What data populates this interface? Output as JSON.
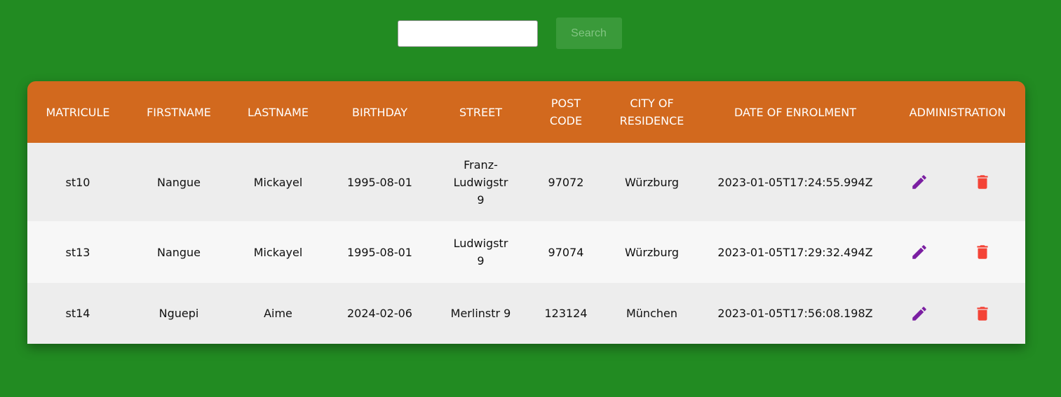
{
  "search": {
    "value": "",
    "placeholder": "",
    "button_label": "Search"
  },
  "table": {
    "headers": [
      "Matricule",
      "Firstname",
      "Lastname",
      "Birthday",
      "Street",
      "Post code",
      "City of residence",
      "Date of enrolment",
      "Administration"
    ],
    "rows": [
      {
        "matricule": "st10",
        "firstname": "Nangue",
        "lastname": "Mickayel",
        "birthday": "1995-08-01",
        "street": "Franz-Ludwigstr 9",
        "post_code": "97072",
        "city": "Würzburg",
        "enrolment": "2023-01-05T17:24:55.994Z"
      },
      {
        "matricule": "st13",
        "firstname": "Nangue",
        "lastname": "Mickayel",
        "birthday": "1995-08-01",
        "street": "Ludwigstr 9",
        "post_code": "97074",
        "city": "Würzburg",
        "enrolment": "2023-01-05T17:29:32.494Z"
      },
      {
        "matricule": "st14",
        "firstname": "Nguepi",
        "lastname": "Aime",
        "birthday": "2024-02-06",
        "street": "Merlinstr 9",
        "post_code": "123124",
        "city": "München",
        "enrolment": "2023-01-05T17:56:08.198Z"
      }
    ]
  },
  "icons": {
    "edit": "pencil-icon",
    "delete": "trash-icon"
  },
  "colors": {
    "background": "#228B22",
    "header": "#D2691E",
    "edit_icon": "#7B1FA2",
    "delete_icon": "#F44336",
    "search_button": "#3a9a3a"
  }
}
